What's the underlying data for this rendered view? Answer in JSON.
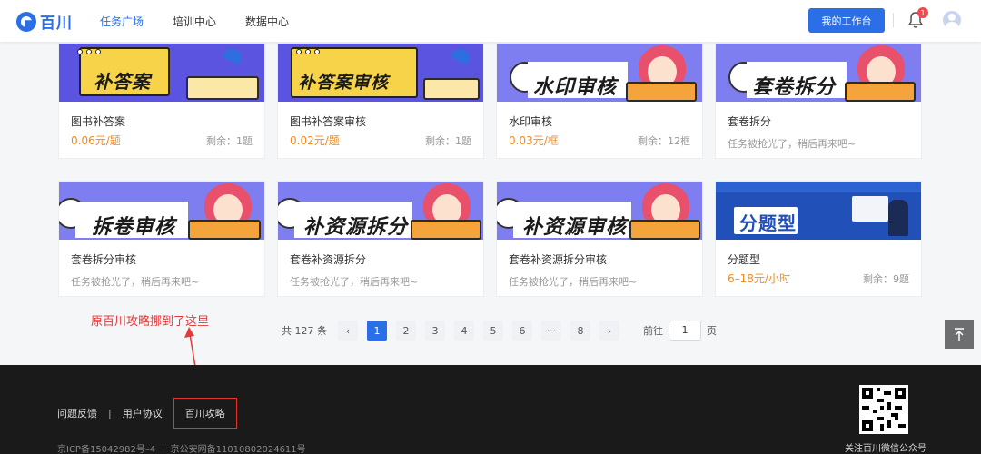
{
  "header": {
    "logo_text": "百川",
    "nav": [
      "任务广场",
      "培训中心",
      "数据中心"
    ],
    "workbench_label": "我的工作台",
    "notification_count": "1"
  },
  "cards": [
    {
      "banner": "补答案",
      "title": "图书补答案",
      "price": "0.06元/题",
      "remain": "剩余：1题"
    },
    {
      "banner": "补答案审核",
      "title": "图书补答案审核",
      "price": "0.02元/题",
      "remain": "剩余：1题"
    },
    {
      "banner": "水印审核",
      "title": "水印审核",
      "price": "0.03元/框",
      "remain": "剩余：12框"
    },
    {
      "banner": "套卷拆分",
      "title": "套卷拆分",
      "empty": "任务被抢光了，稍后再来吧~"
    },
    {
      "banner": "拆卷审核",
      "title": "套卷拆分审核",
      "empty": "任务被抢光了，稍后再来吧~"
    },
    {
      "banner": "补资源拆分",
      "title": "套卷补资源拆分",
      "empty": "任务被抢光了，稍后再来吧~"
    },
    {
      "banner": "补资源审核",
      "title": "套卷补资源拆分审核",
      "empty": "任务被抢光了，稍后再来吧~"
    },
    {
      "banner": "分题型",
      "title": "分题型",
      "price": "6–18元/小时",
      "remain": "剩余：9题"
    }
  ],
  "annotation": "原百川攻略挪到了这里",
  "pagination": {
    "total": "共 127 条",
    "prev": "‹",
    "next": "›",
    "pages": [
      "1",
      "2",
      "3",
      "4",
      "5",
      "6",
      "···",
      "8"
    ],
    "goto_label": "前往",
    "goto_value": "1",
    "page_unit": "页"
  },
  "footer": {
    "feedback": "问题反馈",
    "sep": "|",
    "agreement": "用户协议",
    "guide": "百川攻略",
    "icp": "京ICP备15042982号–4 ｜ 京公安网备11010802024611号",
    "qr_label": "关注百川微信公众号"
  },
  "colors": {
    "accent": "#2b6fe6",
    "price": "#f08a24",
    "annotation": "#e43a3a"
  }
}
